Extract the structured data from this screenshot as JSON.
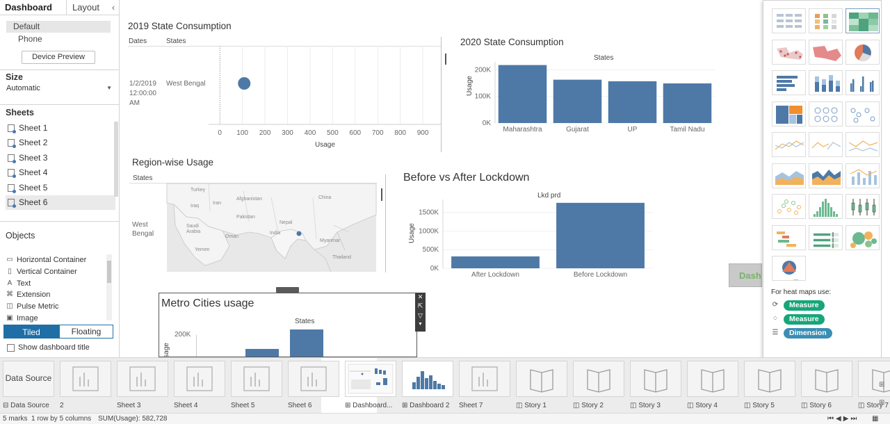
{
  "left_panel": {
    "tabs": [
      "Dashboard",
      "Layout"
    ],
    "collapse_icon": "chevron-left-icon",
    "devices": [
      "Default",
      "Phone"
    ],
    "device_preview_label": "Device Preview",
    "size": {
      "heading": "Size",
      "value": "Automatic"
    },
    "sheets": {
      "heading": "Sheets",
      "items": [
        "Sheet 1",
        "Sheet 2",
        "Sheet 3",
        "Sheet 4",
        "Sheet 5",
        "Sheet 6"
      ],
      "selected": "Sheet 6"
    },
    "objects": {
      "heading": "Objects",
      "items": [
        {
          "label": "Horizontal Container",
          "icon": "horizontal-container-icon"
        },
        {
          "label": "Vertical Container",
          "icon": "vertical-container-icon"
        },
        {
          "label": "Text",
          "icon": "text-icon"
        },
        {
          "label": "Extension",
          "icon": "extension-icon"
        },
        {
          "label": "Pulse Metric",
          "icon": "pulse-metric-icon"
        },
        {
          "label": "Image",
          "icon": "image-icon"
        }
      ]
    },
    "layout_toggle": [
      "Tiled",
      "Floating"
    ],
    "layout_selected": "Tiled",
    "show_title_label": "Show dashboard title"
  },
  "views": {
    "v2019": {
      "title": "2019 State Consumption",
      "col_heads": [
        "Dates",
        "States"
      ],
      "row_date": [
        "1/2/2019",
        "12:00:00",
        "AM"
      ],
      "row_state": "West Bengal",
      "xlabel": "Usage"
    },
    "v2020": {
      "title": "2020 State Consumption",
      "xtitle": "States",
      "ylabel": "Usage"
    },
    "region": {
      "title": "Region-wise Usage",
      "col_head": "States",
      "row_state": [
        "West",
        "Bengal"
      ],
      "map_labels": [
        "Turkey",
        "Iran",
        "Iraq",
        "Afghanistan",
        "Pakistan",
        "China",
        "Saudi",
        "Arabia",
        "Oman",
        "Yemen",
        "India",
        "Myanmar",
        "Thailand",
        "Nepal"
      ]
    },
    "lockdown": {
      "title": "Before vs After Lockdown",
      "xtitle": "Lkd prd",
      "ylabel": "Usage"
    },
    "metro": {
      "title": "Metro Cities usage",
      "xtitle": "States",
      "ylabel": "Usage",
      "ytick": "200K"
    }
  },
  "chart_data": [
    {
      "type": "scatter",
      "title": "2019 State Consumption",
      "xlabel": "Usage",
      "x_ticks": [
        0,
        100,
        200,
        300,
        400,
        500,
        600,
        700,
        800,
        900
      ],
      "xlim": [
        -50,
        980
      ],
      "points": [
        {
          "date": "1/2/2019 12:00:00 AM",
          "state": "West Bengal",
          "x": 108
        }
      ]
    },
    {
      "type": "bar",
      "title": "2020 State Consumption",
      "xlabel": "States",
      "ylabel": "Usage",
      "categories": [
        "Maharashtra",
        "Gujarat",
        "UP",
        "Tamil Nadu"
      ],
      "values": [
        218000,
        163000,
        157000,
        149000
      ],
      "y_ticks": [
        {
          "v": 0,
          "label": "0K"
        },
        {
          "v": 100000,
          "label": "100K"
        },
        {
          "v": 200000,
          "label": "200K"
        }
      ],
      "ylim": [
        0,
        230000
      ]
    },
    {
      "type": "bar",
      "title": "Before vs After Lockdown",
      "xlabel": "Lkd prd",
      "ylabel": "Usage",
      "categories": [
        "After Lockdown",
        "Before Lockdown"
      ],
      "values": [
        320000,
        1760000
      ],
      "y_ticks": [
        {
          "v": 0,
          "label": "0K"
        },
        {
          "v": 500000,
          "label": "500K"
        },
        {
          "v": 1000000,
          "label": "1000K"
        },
        {
          "v": 1500000,
          "label": "1500K"
        }
      ],
      "ylim": [
        0,
        1850000
      ]
    }
  ],
  "show_me": {
    "tiles": [
      "text-table",
      "heat-map",
      "highlight-table",
      "symbol-map",
      "filled-map",
      "pie-chart",
      "horizontal-bars",
      "stacked-bars",
      "side-by-side-bars",
      "treemap",
      "circle-view",
      "side-by-side-circles",
      "lines-continuous",
      "lines-discrete",
      "dual-lines",
      "area-continuous",
      "area-discrete",
      "dual-combination",
      "scatter-plot",
      "histogram",
      "box-and-whisker",
      "gantt-chart",
      "bullet-graph",
      "packed-bubbles",
      "map-more"
    ],
    "active_tile": "highlight-table",
    "note": "For heat maps use:",
    "pills": [
      {
        "label": "Measure",
        "icon": "size-icon",
        "color": "#16a679"
      },
      {
        "label": "Measure",
        "icon": "color-icon",
        "color": "#16a679"
      },
      {
        "label": "Dimension",
        "icon": "detail-icon",
        "color": "#3b8db5"
      }
    ]
  },
  "dash_button_label": "Dash",
  "bottom_tabs": [
    {
      "label": "Data Source",
      "thumb": "Data Source",
      "icon": "database-icon"
    },
    {
      "label": "2",
      "thumb": "",
      "icon": ""
    },
    {
      "label": "Sheet 3",
      "thumb": "",
      "icon": ""
    },
    {
      "label": "Sheet 4",
      "thumb": "",
      "icon": ""
    },
    {
      "label": "Sheet 5",
      "thumb": "",
      "icon": ""
    },
    {
      "label": "Sheet 6",
      "thumb": "",
      "icon": ""
    },
    {
      "label": "Dashboard...",
      "thumb": "",
      "icon": "dashboard-icon"
    },
    {
      "label": "Dashboard 2",
      "thumb": "",
      "icon": "dashboard-icon"
    },
    {
      "label": "Sheet 7",
      "thumb": "",
      "icon": ""
    },
    {
      "label": "Story 1",
      "thumb": "",
      "icon": "story-icon"
    },
    {
      "label": "Story 2",
      "thumb": "",
      "icon": "story-icon"
    },
    {
      "label": "Story 3",
      "thumb": "",
      "icon": "story-icon"
    },
    {
      "label": "Story 4",
      "thumb": "",
      "icon": "story-icon"
    },
    {
      "label": "Story 5",
      "thumb": "",
      "icon": "story-icon"
    },
    {
      "label": "Story 6",
      "thumb": "",
      "icon": "story-icon"
    },
    {
      "label": "Story 7",
      "thumb": "",
      "icon": "story-icon"
    }
  ],
  "status": {
    "marks": "5 marks",
    "rows": "1 row by 5 columns",
    "sum": "SUM(Usage): 582,728"
  },
  "colors": {
    "bar": "#4e79a7",
    "accent": "#1f6fa6"
  }
}
